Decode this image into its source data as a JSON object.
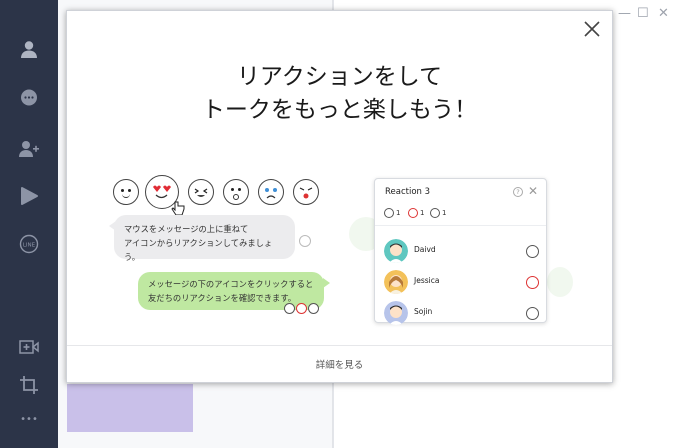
{
  "window": {
    "minimize": "—",
    "maximize": "☐",
    "close": "✕"
  },
  "sidebar": {
    "items": [
      {
        "icon": "person-icon"
      },
      {
        "icon": "chat-icon"
      },
      {
        "icon": "add-friend-icon"
      },
      {
        "icon": "play-icon"
      },
      {
        "icon": "line-icon",
        "label": "LINE"
      },
      {
        "icon": "add-video-icon"
      },
      {
        "icon": "crop-icon"
      },
      {
        "icon": "more-icon",
        "label": "•••"
      }
    ]
  },
  "modal": {
    "title_line1": "リアクションをして",
    "title_line2": "トークをもっと楽しもう！",
    "grey_bubble_line1": "マウスをメッセージの上に重ねて",
    "grey_bubble_line2": "アイコンからリアクションしてみましょう。",
    "green_bubble_line1": "メッセージの下のアイコンをクリックすると",
    "green_bubble_line2": "友だちのリアクションを確認できます。",
    "more_link": "詳細を見る",
    "reaction_card": {
      "title": "Reaction 3",
      "help": "?",
      "close": "✕",
      "counts": [
        "1",
        "1",
        "1"
      ],
      "rows": [
        {
          "name": "Daivd"
        },
        {
          "name": "Jessica"
        },
        {
          "name": "Sojin"
        }
      ]
    }
  },
  "colors": {
    "sidebar": "#2c3448",
    "green_bubble": "#bfe8a1",
    "grey_bubble": "#ececee",
    "accent_purple": "#c9c0e9"
  }
}
